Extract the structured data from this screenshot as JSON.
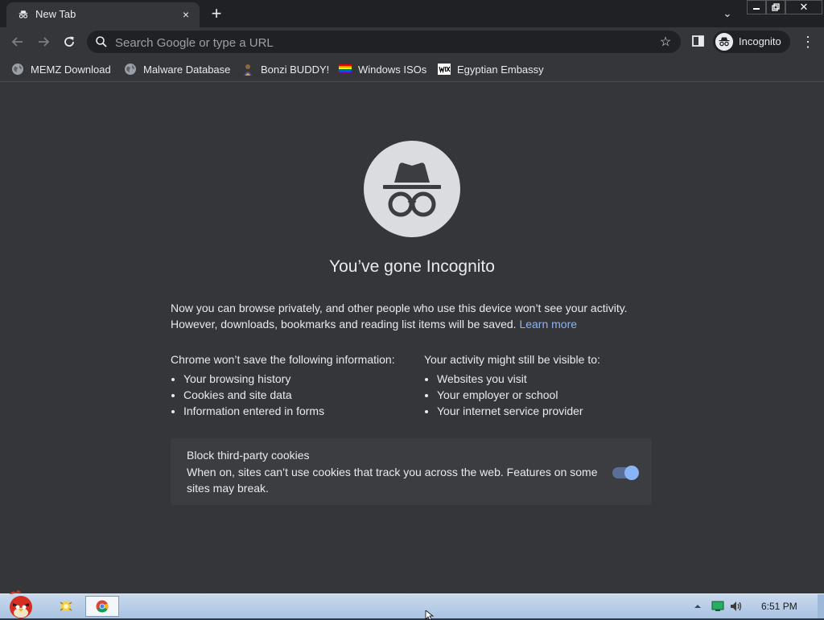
{
  "window": {
    "tab_title": "New Tab",
    "tab_close": "×",
    "new_tab": "+",
    "tab_search": "⌄",
    "minimize": "—",
    "maximize": "❐",
    "close": "✕"
  },
  "toolbar": {
    "omnibox_placeholder": "Search Google or type a URL",
    "profile_label": "Incognito",
    "menu": "⋮"
  },
  "bookmarks": [
    {
      "label": "MEMZ Download",
      "icon": "globe-icon"
    },
    {
      "label": "Malware Database",
      "icon": "globe-icon"
    },
    {
      "label": "Bonzi BUDDY!",
      "icon": "bonzi-icon"
    },
    {
      "label": "Windows ISOs",
      "icon": "rainbow-flag-icon"
    },
    {
      "label": "Egyptian Embassy",
      "icon": "wix-icon"
    }
  ],
  "content": {
    "heading": "You’ve gone Incognito",
    "intro_line1": "Now you can browse privately, and other people who use this device won’t see your activity.",
    "intro_line2": "However, downloads, bookmarks and reading list items will be saved.",
    "learn_more": "Learn more",
    "left_title": "Chrome won’t save the following information:",
    "left_items": [
      "Your browsing history",
      "Cookies and site data",
      "Information entered in forms"
    ],
    "right_title": "Your activity might still be visible to:",
    "right_items": [
      "Websites you visit",
      "Your employer or school",
      "Your internet service provider"
    ],
    "cookie_title": "Block third-party cookies",
    "cookie_desc": "When on, sites can’t use cookies that track you across the web. Features on some sites may break.",
    "cookie_toggle_on": true
  },
  "taskbar": {
    "clock": "6:51 PM"
  },
  "colors": {
    "background": "#35363a",
    "titlebar": "#202124",
    "link": "#8ab4f8",
    "toggle_knob": "#8ab4f8"
  }
}
